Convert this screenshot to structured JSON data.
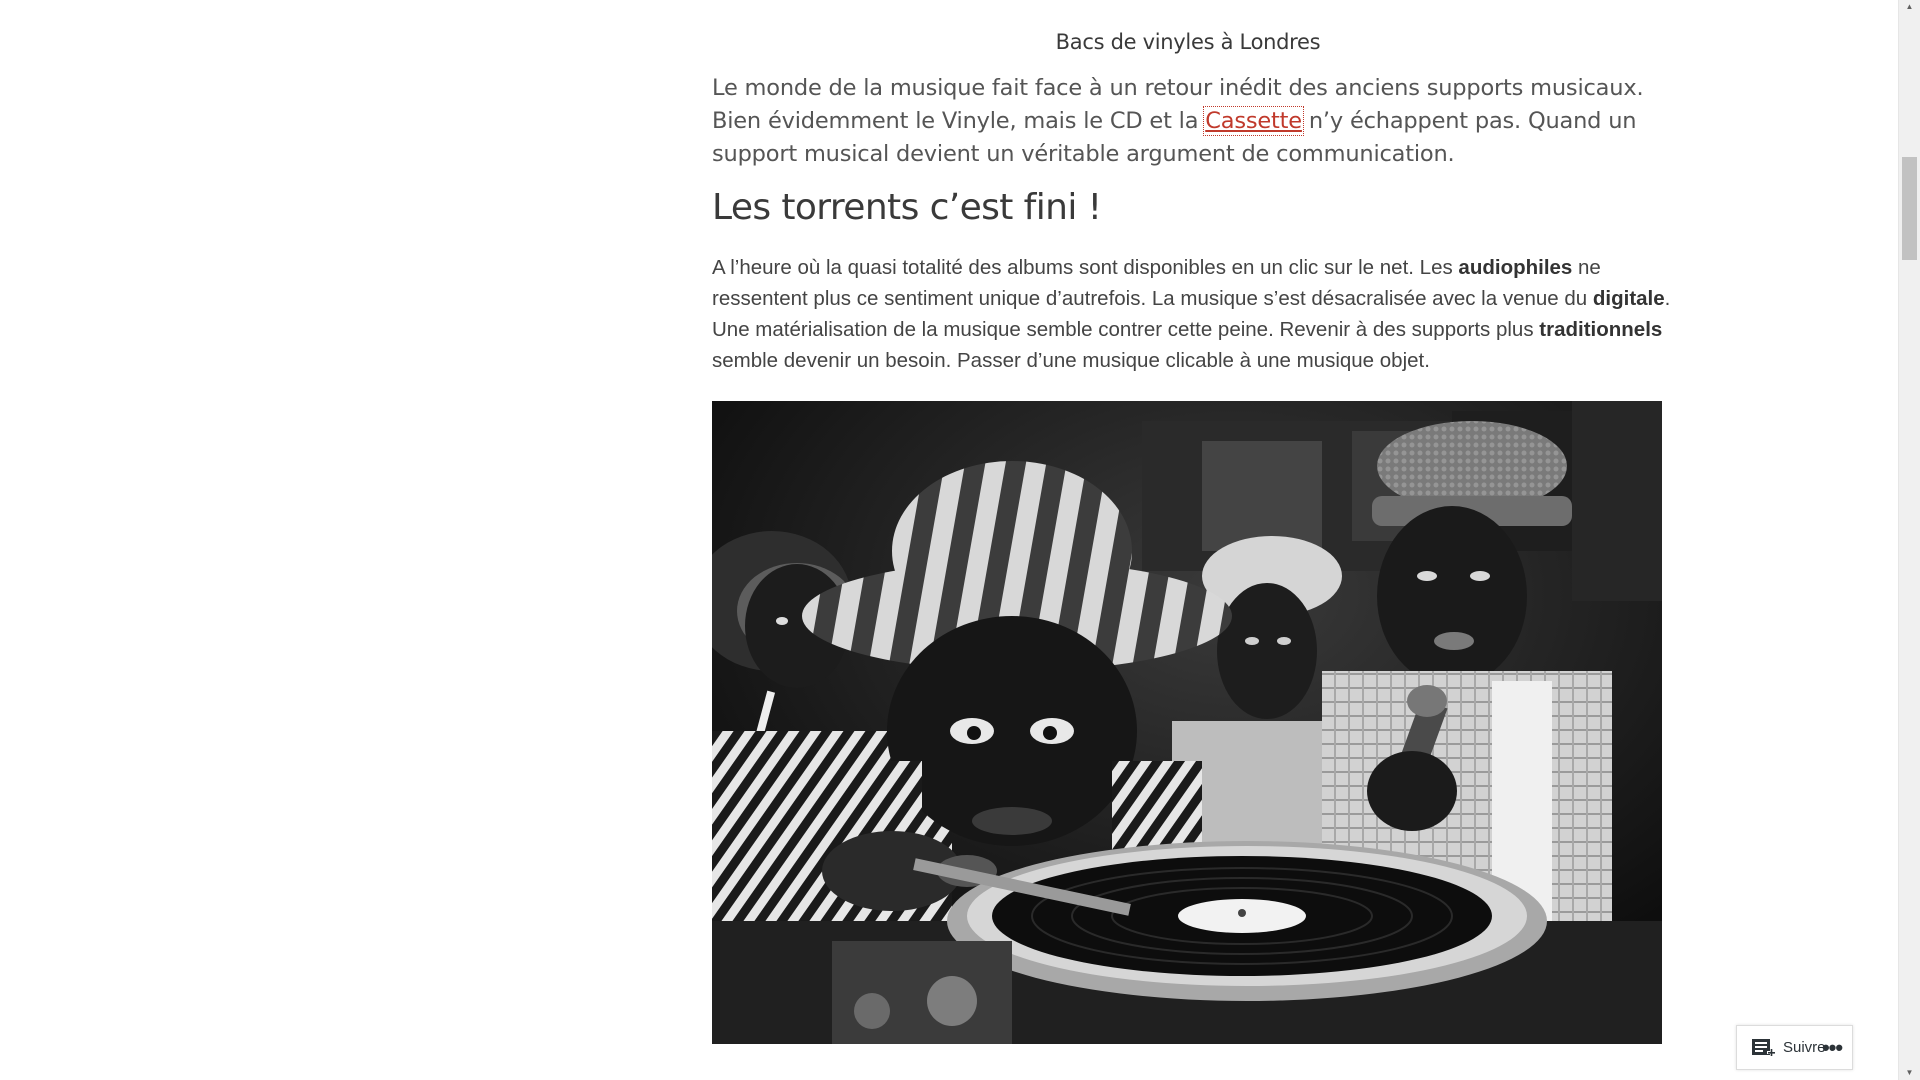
{
  "article": {
    "image_caption": "Bacs de vinyles à Londres",
    "intro": {
      "before_link": "Le monde de la musique fait face à un retour inédit des anciens supports musicaux. Bien évidemment le Vinyle, mais le CD et la ",
      "link_text": "Cassette",
      "after_link": " n’y échappent pas. Quand un support musical devient un véritable argument de communication."
    },
    "heading": "Les torrents c’est fini !",
    "paragraph": {
      "t1": "A l’heure où la quasi totalité des albums sont disponibles en un clic sur le net. Les ",
      "b1": "audiophiles",
      "t2": " ne ressentent plus ce sentiment unique d’autrefois. La musique s’est désacralisée avec la venue du ",
      "b2": "digitale",
      "t3": ". Une matérialisation de la musique semble contrer cette peine. Revenir à des supports plus ",
      "b3": "traditionnels",
      "t4": " semble devenir un besoin. Passer d’une musique clicable à une musique objet."
    }
  },
  "follow_widget": {
    "follow_label": "Suivre",
    "follow_icon": "reader-follow-icon",
    "more_icon": "ellipsis-icon",
    "more_label": "•••"
  },
  "scrollbar": {
    "up_arrow": "▲",
    "down_arrow": "▼"
  }
}
